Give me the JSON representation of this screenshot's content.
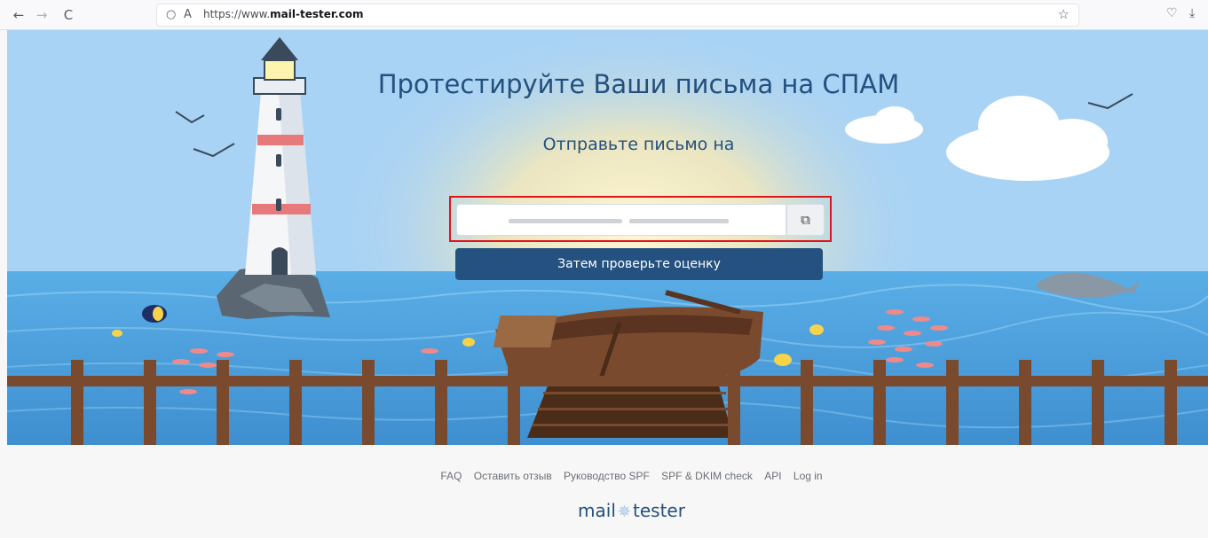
{
  "browser": {
    "url_prefix": "https://www.",
    "url_domain": "mail-tester.com",
    "back_icon": "←",
    "forward_icon": "→",
    "reload_icon": "C",
    "shield_icon": "○",
    "lock_icon": "A",
    "bookmark_icon": "☆",
    "pocket_icon": "♡",
    "download_icon": "⤓"
  },
  "hero": {
    "title": "Протестируйте Ваши письма на СПАМ",
    "subtitle": "Отправьте письмо на",
    "email_value": "",
    "copy_icon": "⧉",
    "check_button_label": "Затем проверьте оценку"
  },
  "footer": {
    "links": [
      "FAQ",
      "Оставить отзыв",
      "Руководство SPF",
      "SPF & DKIM check",
      "API",
      "Log in"
    ],
    "logo_left": "mail",
    "logo_right": "tester",
    "logo_icon": "✵"
  },
  "colors": {
    "sky": "#a9d3f5",
    "sea": "#4d9fdc",
    "brand": "#245180",
    "highlight": "#e0141b"
  }
}
